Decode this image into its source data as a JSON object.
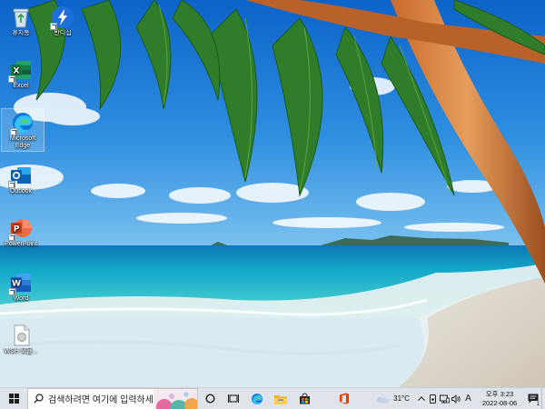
{
  "desktop": {
    "icons": [
      {
        "label": "휴지통"
      },
      {
        "label": "반디집"
      },
      {
        "label": "Excel"
      },
      {
        "label": "Microsoft Edge"
      },
      {
        "label": "Outlook"
      },
      {
        "label": "PowerPoint"
      },
      {
        "label": "Word"
      },
      {
        "label": "WSH 모듈..."
      }
    ]
  },
  "taskbar": {
    "search_placeholder": "검색하려면 여기에 입력하세",
    "weather": {
      "temp": "31°C"
    },
    "ime_indicator": "A",
    "clock": {
      "time": "오후 3:23",
      "date": "2022-08-06"
    },
    "notification_count": "1"
  },
  "colors": {
    "taskbar_bg": "#dfe3ea",
    "accent": "#0078d4"
  }
}
